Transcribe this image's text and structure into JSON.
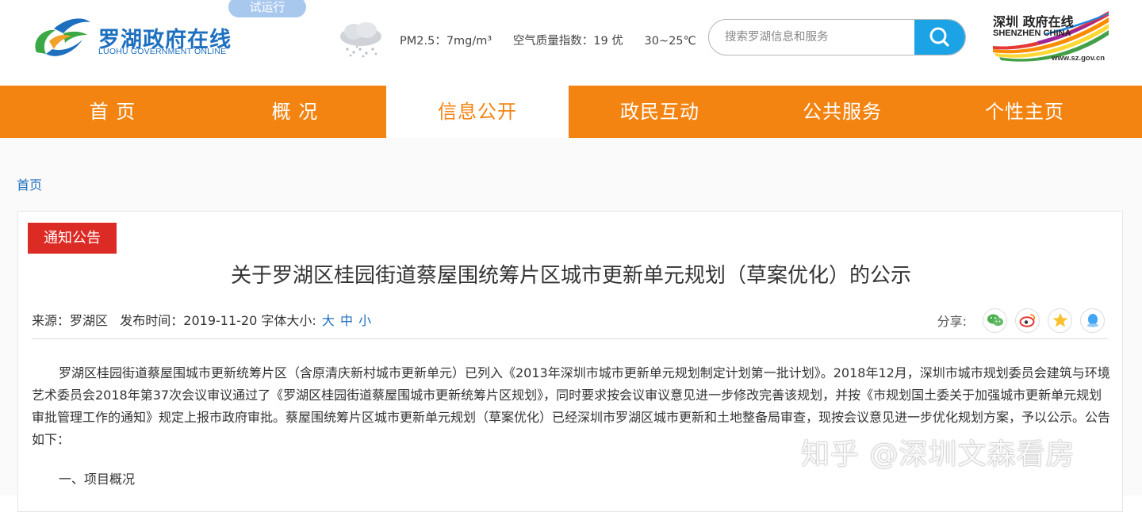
{
  "header": {
    "logo_cn": "罗湖政府在线",
    "logo_en": "LUOHU GOVERNMENT ONLINE",
    "trial_badge": "试运行",
    "weather": {
      "icon": "rain-cloud-icon",
      "pm25": "PM2.5：7mg/m³",
      "aqi": "空气质量指数：19 优",
      "temperature": "30~25℃"
    },
    "search": {
      "placeholder": "搜索罗湖信息和服务",
      "value": ""
    },
    "shenzhen_logo": {
      "cn": "深圳 政府在线",
      "en": "SHENZHEN CHINA",
      "url": "www.sz.gov.cn"
    }
  },
  "nav": {
    "items": [
      {
        "label": "首 页",
        "active": false
      },
      {
        "label": "概 况",
        "active": false
      },
      {
        "label": "信息公开",
        "active": true
      },
      {
        "label": "政民互动",
        "active": false
      },
      {
        "label": "公共服务",
        "active": false
      },
      {
        "label": "个性主页",
        "active": false
      }
    ]
  },
  "breadcrumb": "首页",
  "article": {
    "tag": "通知公告",
    "title": "关于罗湖区桂园街道蔡屋围统筹片区城市更新单元规划（草案优化）的公示",
    "meta": {
      "source": "来源：罗湖区",
      "publish": "发布时间：2019-11-20",
      "font_size_label": "字体大小:",
      "size_large": "大",
      "size_medium": "中",
      "size_small": "小"
    },
    "share_label": "分享:",
    "share_icons": [
      "wechat-icon",
      "weibo-icon",
      "qzone-icon",
      "qq-icon"
    ],
    "paragraph": "罗湖区桂园街道蔡屋围城市更新统筹片区（含原清庆新村城市更新单元）已列入《2013年深圳市城市更新单元规划制定计划第一批计划》。2018年12月，深圳市城市规划委员会建筑与环境艺术委员会2018年第37次会议审议通过了《罗湖区桂园街道蔡屋围城市更新统筹片区规划》，同时要求按会议审议意见进一步修改完善该规划，并按《市规划国土委关于加强城市更新单元规划审批管理工作的通知》规定上报市政府审批。蔡屋围统筹片区城市更新单元规划（草案优化）已经深圳市罗湖区城市更新和土地整备局审查，现按会议意见进一步优化规划方案，予以公示。公告如下：",
    "section_1": "一、项目概况"
  },
  "watermark": "知乎 @深圳文森看房",
  "colors": {
    "nav_orange": "#f48412",
    "link_blue": "#1d6fc0",
    "tag_red": "#dc2b25",
    "search_button": "#1ca3e6"
  }
}
